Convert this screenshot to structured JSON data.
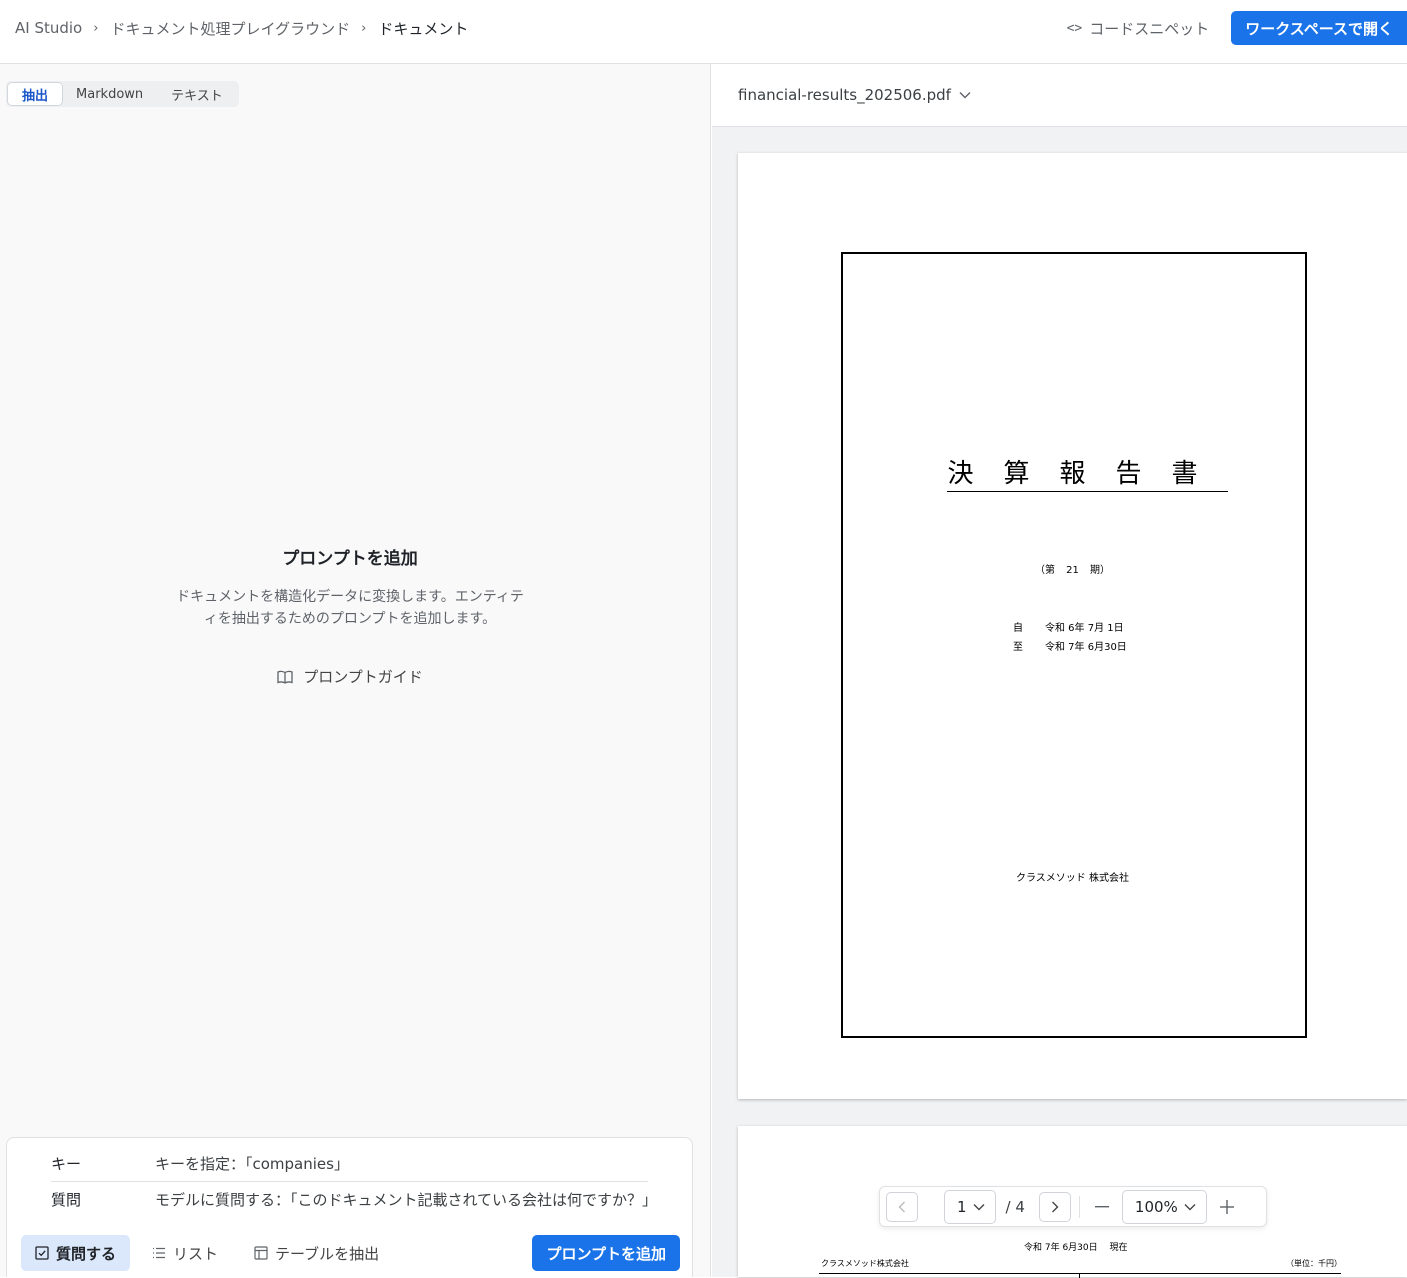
{
  "breadcrumb": {
    "items": [
      "AI Studio",
      "ドキュメント処理プレイグラウンド",
      "ドキュメント"
    ]
  },
  "header": {
    "code_snippet_label": "コードスニペット",
    "open_workspace_label": "ワークスペースで開く"
  },
  "tabs": [
    {
      "label": "抽出",
      "active": true
    },
    {
      "label": "Markdown",
      "active": false
    },
    {
      "label": "テキスト",
      "active": false
    }
  ],
  "empty_state": {
    "title": "プロンプトを追加",
    "description": "ドキュメントを構造化データに変換します。エンティティを抽出するためのプロンプトを追加します。",
    "guide_label": "プロンプトガイド"
  },
  "composer": {
    "key_label": "キー",
    "key_placeholder": "キーを指定：「companies」",
    "question_label": "質問",
    "question_placeholder": "モデルに質問する：「このドキュメント記載されている会社は何ですか？」",
    "actions": [
      {
        "label": "質問する",
        "icon": "checkbox-icon",
        "active": true
      },
      {
        "label": "リスト",
        "icon": "list-icon",
        "active": false
      },
      {
        "label": "テーブルを抽出",
        "icon": "table-icon",
        "active": false
      }
    ],
    "add_prompt_label": "プロンプトを追加"
  },
  "viewer": {
    "file_name": "financial-results_202506.pdf",
    "page1": {
      "title": "決算報告書",
      "period": "（第 21 期）",
      "from_label": "自",
      "from_date": "令和 6年 7月 1日",
      "to_label": "至",
      "to_date": "令和 7年 6月30日",
      "company": "クラスメソッド 株式会社"
    },
    "page2": {
      "date": "令和 7年 6月30日　 現在",
      "company": "クラスメソッド株式会社",
      "unit": "（単位：千円）"
    },
    "pager": {
      "current_page": "1",
      "total": "/ 4",
      "zoom": "100%"
    }
  },
  "colors": {
    "primary": "#1a73e8",
    "active_tab_text": "#1a56c9",
    "active_action_bg": "#dbe8fb"
  }
}
